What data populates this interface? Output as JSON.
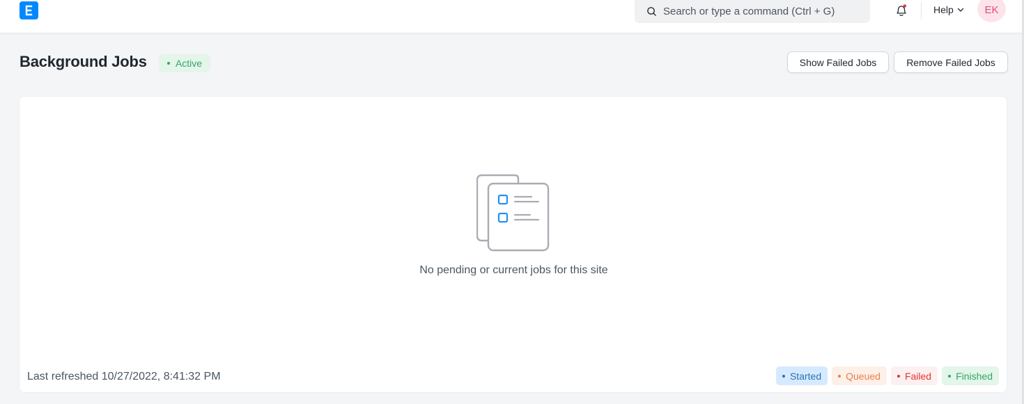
{
  "navbar": {
    "logo_icon": "erpnext-logo-icon",
    "search_placeholder": "Search or type a command (Ctrl + G)",
    "notification_icon": "bell-icon",
    "help_label": "Help",
    "avatar_initials": "EK"
  },
  "page": {
    "title": "Background Jobs",
    "status": "Active",
    "actions": {
      "show_failed": "Show Failed Jobs",
      "remove_failed": "Remove Failed Jobs"
    }
  },
  "card": {
    "empty_icon": "empty-list-icon",
    "empty_message": "No pending or current jobs for this site",
    "last_refreshed": "Last refreshed 10/27/2022, 8:41:32 PM",
    "legend": [
      "Started",
      "Queued",
      "Failed",
      "Finished"
    ]
  },
  "colors": {
    "primary": "#0089ff",
    "started": "#2c6fb6",
    "queued": "#e9804d",
    "failed": "#e03636",
    "finished": "#30a66d"
  }
}
